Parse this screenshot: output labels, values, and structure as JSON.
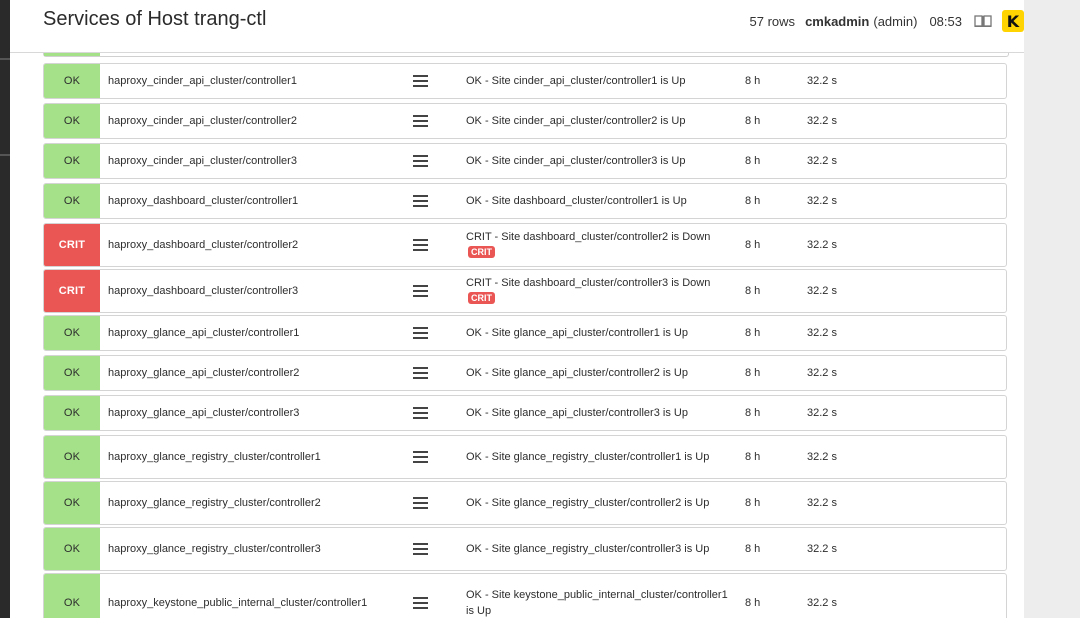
{
  "header": {
    "title": "Services of Host trang-ctl",
    "rows": "57 rows",
    "user": "cmkadmin",
    "role": "(admin)",
    "time": "08:53",
    "book_icon": "book-icon",
    "logo_icon": "checkmk-logo",
    "logo_letter": "K"
  },
  "colors": {
    "ok": "#a4e189",
    "crit": "#e95654"
  },
  "services": [
    {
      "state": "OK",
      "name": "haproxy_cinder_api_cluster/controller1",
      "output": "OK - Site cinder_api_cluster/controller1 is Up",
      "badge": "",
      "age": "8 h",
      "check": "32.2 s"
    },
    {
      "state": "OK",
      "name": "haproxy_cinder_api_cluster/controller2",
      "output": "OK - Site cinder_api_cluster/controller2 is Up",
      "badge": "",
      "age": "8 h",
      "check": "32.2 s"
    },
    {
      "state": "OK",
      "name": "haproxy_cinder_api_cluster/controller3",
      "output": "OK - Site cinder_api_cluster/controller3 is Up",
      "badge": "",
      "age": "8 h",
      "check": "32.2 s"
    },
    {
      "state": "OK",
      "name": "haproxy_dashboard_cluster/controller1",
      "output": "OK - Site dashboard_cluster/controller1 is Up",
      "badge": "",
      "age": "8 h",
      "check": "32.2 s"
    },
    {
      "state": "CRIT",
      "name": "haproxy_dashboard_cluster/controller2",
      "output": "CRIT - Site dashboard_cluster/controller2 is Down",
      "badge": "CRIT",
      "age": "8 h",
      "check": "32.2 s"
    },
    {
      "state": "CRIT",
      "name": "haproxy_dashboard_cluster/controller3",
      "output": "CRIT - Site dashboard_cluster/controller3 is Down",
      "badge": "CRIT",
      "age": "8 h",
      "check": "32.2 s"
    },
    {
      "state": "OK",
      "name": "haproxy_glance_api_cluster/controller1",
      "output": "OK - Site glance_api_cluster/controller1 is Up",
      "badge": "",
      "age": "8 h",
      "check": "32.2 s"
    },
    {
      "state": "OK",
      "name": "haproxy_glance_api_cluster/controller2",
      "output": "OK - Site glance_api_cluster/controller2 is Up",
      "badge": "",
      "age": "8 h",
      "check": "32.2 s"
    },
    {
      "state": "OK",
      "name": "haproxy_glance_api_cluster/controller3",
      "output": "OK - Site glance_api_cluster/controller3 is Up",
      "badge": "",
      "age": "8 h",
      "check": "32.2 s"
    },
    {
      "state": "OK",
      "name": "haproxy_glance_registry_cluster/controller1",
      "output": "OK - Site glance_registry_cluster/controller1 is Up",
      "badge": "",
      "age": "8 h",
      "check": "32.2 s"
    },
    {
      "state": "OK",
      "name": "haproxy_glance_registry_cluster/controller2",
      "output": "OK - Site glance_registry_cluster/controller2 is Up",
      "badge": "",
      "age": "8 h",
      "check": "32.2 s"
    },
    {
      "state": "OK",
      "name": "haproxy_glance_registry_cluster/controller3",
      "output": "OK - Site glance_registry_cluster/controller3 is Up",
      "badge": "",
      "age": "8 h",
      "check": "32.2 s"
    },
    {
      "state": "OK",
      "name": "haproxy_keystone_public_internal_cluster/controller1",
      "output": "OK - Site keystone_public_internal_cluster/controller1 is Up",
      "badge": "",
      "age": "8 h",
      "check": "32.2 s"
    }
  ]
}
